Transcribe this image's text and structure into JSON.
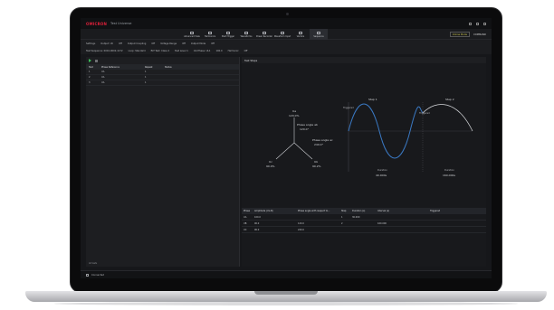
{
  "app": {
    "logo": "OMICRON",
    "title": "Test Universe"
  },
  "ribbon": {
    "tabs": [
      {
        "label": "Advanced View",
        "icon": "advanced-view-icon"
      },
      {
        "label": "Harmonics",
        "icon": "harmonics-icon"
      },
      {
        "label": "Start Trigger",
        "icon": "trigger-icon"
      },
      {
        "label": "Waveforms",
        "icon": "waveform-icon"
      },
      {
        "label": "Power Recorder",
        "icon": "recorder-icon"
      },
      {
        "label": "Waveform Input",
        "icon": "input-icon"
      },
      {
        "label": "Vectors",
        "icon": "vector-icon"
      },
      {
        "label": "Sequence",
        "icon": "sequence-icon"
      }
    ],
    "active_tab": 7,
    "badge": "Online Mode",
    "user": "COMMAND"
  },
  "settings": {
    "row1": [
      "Settings",
      "Output: UC",
      "Off",
      "Output Coupling",
      "Off",
      "Voltage Range",
      "Off",
      "Output Mode",
      "Off"
    ],
    "row2": [
      "Test Sequence: 0010-0002-1172",
      "Loop: Standard",
      "ELT Test: Class 2",
      "Test Level 1",
      "ULI Phase: UL1",
      "100.0",
      "Harmonic",
      "Off"
    ]
  },
  "left": {
    "headers": [
      "Test",
      "Phase Reference",
      "Repeat",
      "Status"
    ],
    "rows": [
      [
        "1",
        "UA",
        "1",
        ""
      ],
      [
        "2",
        "UA",
        "1",
        ""
      ],
      [
        "3",
        "UA",
        "1",
        ""
      ]
    ],
    "footer": "All tests"
  },
  "right": {
    "title": "Test Steps",
    "vectors": {
      "ua_label": "Ua",
      "ua_value": "120.0%",
      "phase_ab": "Phase angle ab",
      "phase_ab_value": "120.0°",
      "phase_ac": "Phase angle ac",
      "phase_ac_value": "240.0°",
      "uc_label": "Uc",
      "uc_value": "90.0%",
      "ub_label": "Ub",
      "ub_value": "90.2%"
    },
    "steps": {
      "step1": "Step 1",
      "step2": "Step 2",
      "trigger_left": "Triggered",
      "trigger_right": "Triggered",
      "duration1": "Duration",
      "duration1_value": "40.000s",
      "duration2": "Duration",
      "duration2_value": "160.000s"
    },
    "table": {
      "headers": [
        "Phase",
        "Amplitude (UL-N)",
        "Phase angle with respect to...",
        "Step",
        "Duration (s)",
        "Interval (s)",
        "Triggered"
      ],
      "rows": [
        [
          "UA",
          "100.0",
          "",
          "1",
          "30.000",
          "",
          ""
        ],
        [
          "UB",
          "90.0",
          "120.0",
          "2",
          "",
          "160.000",
          ""
        ],
        [
          "UC",
          "90.0",
          "240.0",
          "",
          "",
          "",
          ""
        ]
      ]
    }
  },
  "status": {
    "text": "Connected"
  },
  "colors": {
    "accent": "#e0203a",
    "sine": "#3a78c2",
    "panel": "#1d1e21",
    "go": "#3cbf5a"
  }
}
